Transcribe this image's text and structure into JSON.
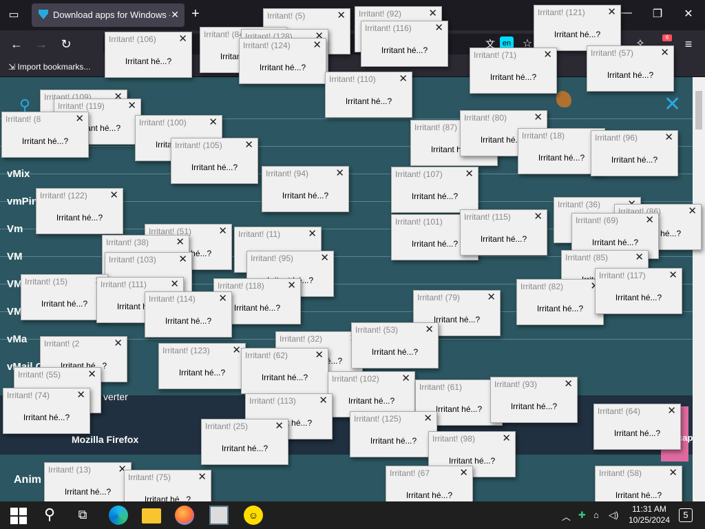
{
  "browser": {
    "tab_title": "Download apps for Windows - |",
    "import_bookmarks": "Import bookmarks...",
    "translate_badge": "en",
    "extension_badge": "6"
  },
  "page": {
    "app_list": [
      "vMix",
      "vmPin",
      "Vm",
      "VM",
      "VM",
      "VM",
      "vMa",
      "vMail C"
    ],
    "converter_label": "verter",
    "firefox_label": "Mozilla Firefox",
    "anim_label": "Anim",
    "cap_label": "cap"
  },
  "dialog_message": "Irritant hé...?",
  "dialogs": [
    {
      "title": "Irritant! (5)",
      "message": ""
    },
    {
      "title": "Irritant! (92)",
      "message": ""
    },
    {
      "title": "Irritant! (121)",
      "message": "Irritant hé...?"
    },
    {
      "title": "Irritant! (84)",
      "message": "Irritant hé...?"
    },
    {
      "title": "Irritant! (128)",
      "message": ""
    },
    {
      "title": "Irritant! (116)",
      "message": "Irritant hé...?"
    },
    {
      "title": "Irritant! (106)",
      "message": "Irritant hé...?"
    },
    {
      "title": "Irritant! (124)",
      "message": "Irritant hé...?"
    },
    {
      "title": "Irritant! (71)",
      "message": "Irritant hé...?"
    },
    {
      "title": "Irritant! (57)",
      "message": "Irritant hé...?"
    },
    {
      "title": "Irritant! (110)",
      "message": "Irritant hé...?"
    },
    {
      "title": "Irritant! (109)",
      "message": "Irritant hé...?"
    },
    {
      "title": "Irritant! (119)",
      "message": "Irritant hé...?"
    },
    {
      "title": "Irritant! (8",
      "message": "Irritant hé...?"
    },
    {
      "title": "Irritant! (100)",
      "message": "Irritant hé...?"
    },
    {
      "title": "Irritant! (105)",
      "message": "Irritant hé...?"
    },
    {
      "title": "Irritant! (87)",
      "message": "Irritant hé...?"
    },
    {
      "title": "Irritant! (80)",
      "message": "Irritant hé...?"
    },
    {
      "title": "Irritant! (18)",
      "message": "Irritant hé...?"
    },
    {
      "title": "Irritant! (96)",
      "message": "Irritant hé...?"
    },
    {
      "title": "Irritant! (94)",
      "message": "Irritant hé...?"
    },
    {
      "title": "Irritant! (107)",
      "message": "Irritant hé...?"
    },
    {
      "title": "Irritant! (122)",
      "message": "Irritant hé...?"
    },
    {
      "title": "Irritant! (36)",
      "message": "Irritant hé...?"
    },
    {
      "title": "Irritant! (86)",
      "message": "Irritant hé...?"
    },
    {
      "title": "Irritant! (101)",
      "message": "Irritant hé...?"
    },
    {
      "title": "Irritant! (115)",
      "message": "Irritant hé...?"
    },
    {
      "title": "Irritant! (69)",
      "message": "Irritant hé...?"
    },
    {
      "title": "Irritant! (51)",
      "message": "Irritant hé...?"
    },
    {
      "title": "Irritant! (11)",
      "message": "Irritant hé...?"
    },
    {
      "title": "Irritant! (38)",
      "message": "Irritant hé...?"
    },
    {
      "title": "Irritant! (103)",
      "message": "Irritant hé...?"
    },
    {
      "title": "Irritant! (95)",
      "message": "Irritant hé...?"
    },
    {
      "title": "Irritant! (85)",
      "message": "Irritant hé...?"
    },
    {
      "title": "Irritant! (15)",
      "message": "Irritant hé...?"
    },
    {
      "title": "Irritant! (111)",
      "message": "Irritant hé...?"
    },
    {
      "title": "Irritant! (118)",
      "message": "Irritant hé...?"
    },
    {
      "title": "Irritant! (82)",
      "message": "Irritant hé...?"
    },
    {
      "title": "Irritant! (117)",
      "message": "Irritant hé...?"
    },
    {
      "title": "Irritant! (114)",
      "message": "Irritant hé...?"
    },
    {
      "title": "Irritant! (79)",
      "message": "Irritant hé...?"
    },
    {
      "title": "Irritant! (32)",
      "message": "Irritant hé...?"
    },
    {
      "title": "Irritant! (53)",
      "message": "Irritant hé...?"
    },
    {
      "title": "Irritant! (2",
      "message": "Irritant hé...?"
    },
    {
      "title": "Irritant! (123)",
      "message": "Irritant hé...?"
    },
    {
      "title": "Irritant! (62)",
      "message": "Irritant hé...?"
    },
    {
      "title": "Irritant! (55)",
      "message": "Irritant hé...?"
    },
    {
      "title": "Irritant! (102)",
      "message": "Irritant hé...?"
    },
    {
      "title": "Irritant! (61)",
      "message": "Irritant hé...?"
    },
    {
      "title": "Irritant! (93)",
      "message": "Irritant hé...?"
    },
    {
      "title": "Irritant! (74)",
      "message": "Irritant hé...?"
    },
    {
      "title": "Irritant! (113)",
      "message": "Irritant hé...?"
    },
    {
      "title": "Irritant! (25)",
      "message": "Irritant hé...?"
    },
    {
      "title": "Irritant! (125)",
      "message": "Irritant hé...?"
    },
    {
      "title": "Irritant! (98)",
      "message": "Irritant hé...?"
    },
    {
      "title": "Irritant! (64)",
      "message": "Irritant hé...?"
    },
    {
      "title": "Irritant! (13)",
      "message": "Irritant hé...?"
    },
    {
      "title": "Irritant! (75)",
      "message": "Irritant hé...?"
    },
    {
      "title": "Irritant! (67",
      "message": "Irritant hé...?"
    },
    {
      "title": "Irritant! (58)",
      "message": "Irritant hé...?"
    }
  ],
  "taskbar": {
    "time": "11:31 AM",
    "date": "10/25/2024",
    "notifications": "5"
  }
}
